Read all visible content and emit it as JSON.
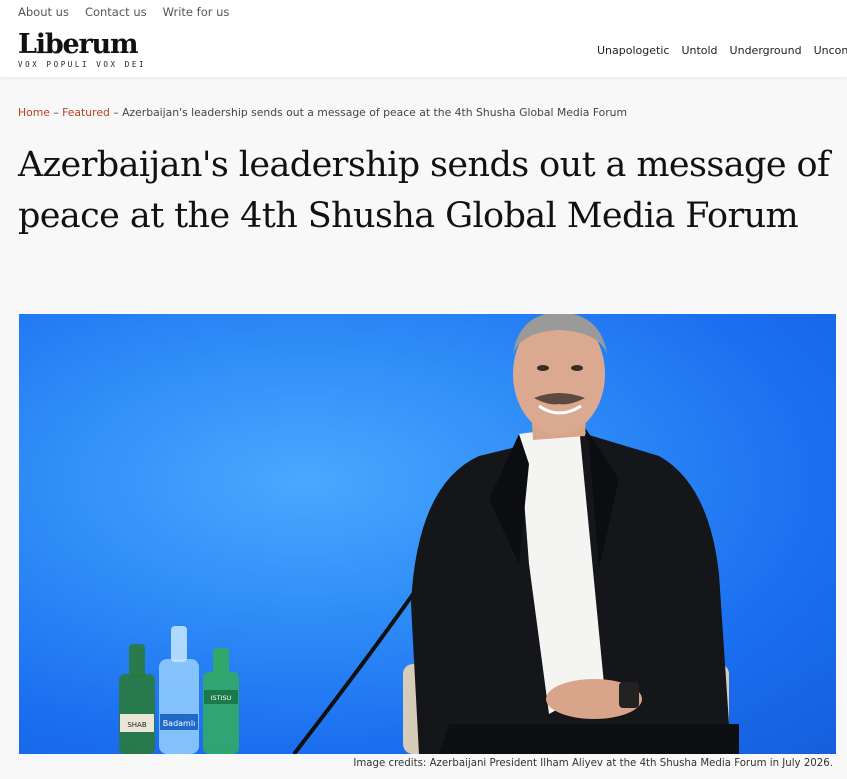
{
  "topnav": {
    "about": "About us",
    "contact": "Contact us",
    "write": "Write for us"
  },
  "logo": {
    "name": "Liberum",
    "tagline": "VOX POPULI VOX DEI"
  },
  "mainnav": {
    "items": [
      "Unapologetic",
      "Untold",
      "Underground",
      "Unconve"
    ]
  },
  "breadcrumb": {
    "home": "Home",
    "sep1": " – ",
    "featured": "Featured",
    "sep2": " – ",
    "current": "Azerbaijan's leadership sends out a message of peace at the 4th Shusha Global Media Forum"
  },
  "article": {
    "title": "Azerbaijan's leadership sends out a message of peace at the 4th Shusha Global Media Forum"
  },
  "image": {
    "bottle_labels": [
      "SHAB",
      "Badamlı",
      "ISTISU"
    ],
    "caption": "Image credits: Azerbaijani President Ilham Aliyev at the 4th Shusha Media Forum in July 2026."
  }
}
